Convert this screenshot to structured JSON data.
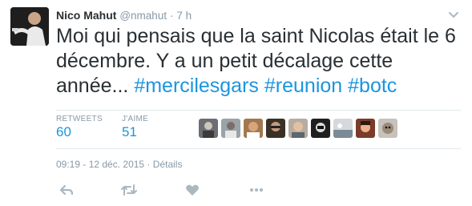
{
  "author": {
    "name": "Nico Mahut",
    "handle": "@nmahut",
    "separator": "·",
    "time_ago": "7 h"
  },
  "tweet": {
    "text_plain": "Moi qui pensais que la saint Nicolas était le 6 décembre. Y a un petit décalage cette année... ",
    "hashtags": [
      "#mercilesgars",
      "#reunion",
      "#botc"
    ]
  },
  "stats": {
    "retweets_label": "RETWEETS",
    "retweets_value": "60",
    "likes_label": "J'AIME",
    "likes_value": "51"
  },
  "likers_count": 9,
  "meta": {
    "timestamp": "09:19 - 12 déc. 2015",
    "separator": "·",
    "details_label": "Détails"
  },
  "actions": {
    "reply_icon": "reply-icon",
    "retweet_icon": "retweet-icon",
    "like_icon": "heart-icon",
    "more_icon": "more-icon"
  },
  "colors": {
    "text": "#292f33",
    "muted": "#8899a6",
    "link": "#1b95e0",
    "divider": "#e1e8ed",
    "icon": "#aab8c2"
  }
}
